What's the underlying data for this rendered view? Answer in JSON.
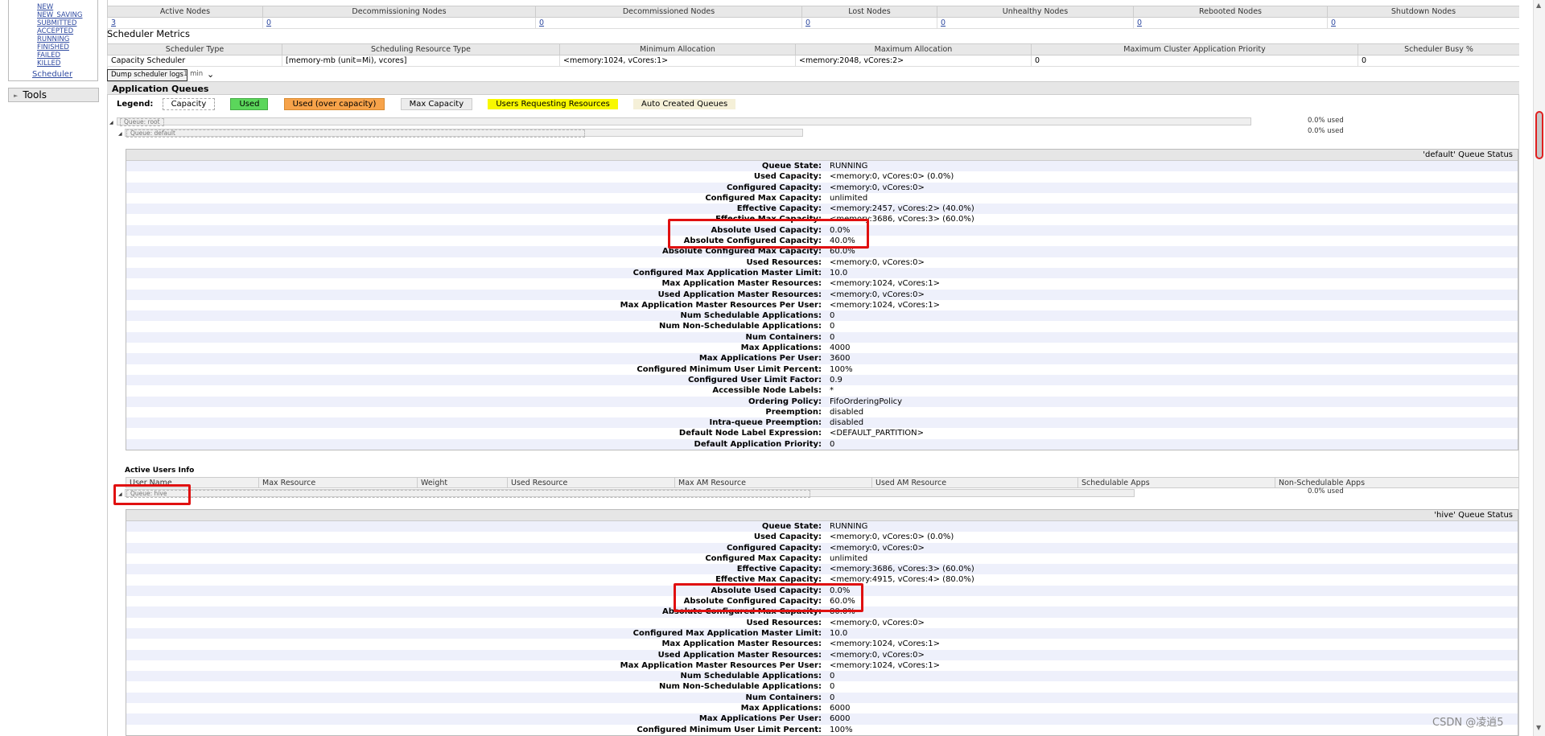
{
  "nav": {
    "states": [
      "NEW",
      "NEW_SAVING",
      "SUBMITTED",
      "ACCEPTED",
      "RUNNING",
      "FINISHED",
      "FAILED",
      "KILLED"
    ],
    "scheduler": "Scheduler",
    "tools": "Tools"
  },
  "cluster_nodes": {
    "headers": [
      "Active Nodes",
      "Decommissioning Nodes",
      "Decommissioned Nodes",
      "Lost Nodes",
      "Unhealthy Nodes",
      "Rebooted Nodes",
      "Shutdown Nodes"
    ],
    "values": [
      "3",
      "0",
      "0",
      "0",
      "0",
      "0",
      "0"
    ]
  },
  "scheduler_metrics": {
    "title": "Scheduler Metrics",
    "headers": [
      "Scheduler Type",
      "Scheduling Resource Type",
      "Minimum Allocation",
      "Maximum Allocation",
      "Maximum Cluster Application Priority",
      "Scheduler Busy %"
    ],
    "values": [
      "Capacity Scheduler",
      "[memory-mb (unit=Mi), vcores]",
      "<memory:1024, vCores:1>",
      "<memory:2048, vCores:2>",
      "0",
      "0"
    ]
  },
  "dump": {
    "button": "Dump scheduler logs",
    "interval": "1 min"
  },
  "app_queues": {
    "title": "Application Queues",
    "legend_label": "Legend:",
    "legend": [
      "Capacity",
      "Used",
      "Used (over capacity)",
      "Max Capacity",
      "Users Requesting Resources",
      "Auto Created Queues"
    ],
    "queues": [
      {
        "name": "Queue: root",
        "used": "0.0% used"
      },
      {
        "name": "Queue: default",
        "used": "0.0% used"
      },
      {
        "name": "Queue: hive",
        "used": "0.0% used"
      }
    ]
  },
  "default_status": {
    "title": "'default' Queue Status",
    "rows": [
      [
        "Queue State:",
        "RUNNING"
      ],
      [
        "Used Capacity:",
        "<memory:0, vCores:0> (0.0%)"
      ],
      [
        "Configured Capacity:",
        "<memory:0, vCores:0>"
      ],
      [
        "Configured Max Capacity:",
        "unlimited"
      ],
      [
        "Effective Capacity:",
        "<memory:2457, vCores:2> (40.0%)"
      ],
      [
        "Effective Max Capacity:",
        "<memory:3686, vCores:3> (60.0%)"
      ],
      [
        "Absolute Used Capacity:",
        "0.0%"
      ],
      [
        "Absolute Configured Capacity:",
        "40.0%"
      ],
      [
        "Absolute Configured Max Capacity:",
        "60.0%"
      ],
      [
        "Used Resources:",
        "<memory:0, vCores:0>"
      ],
      [
        "Configured Max Application Master Limit:",
        "10.0"
      ],
      [
        "Max Application Master Resources:",
        "<memory:1024, vCores:1>"
      ],
      [
        "Used Application Master Resources:",
        "<memory:0, vCores:0>"
      ],
      [
        "Max Application Master Resources Per User:",
        "<memory:1024, vCores:1>"
      ],
      [
        "Num Schedulable Applications:",
        "0"
      ],
      [
        "Num Non-Schedulable Applications:",
        "0"
      ],
      [
        "Num Containers:",
        "0"
      ],
      [
        "Max Applications:",
        "4000"
      ],
      [
        "Max Applications Per User:",
        "3600"
      ],
      [
        "Configured Minimum User Limit Percent:",
        "100%"
      ],
      [
        "Configured User Limit Factor:",
        "0.9"
      ],
      [
        "Accessible Node Labels:",
        "*"
      ],
      [
        "Ordering Policy:",
        "FifoOrderingPolicy"
      ],
      [
        "Preemption:",
        "disabled"
      ],
      [
        "Intra-queue Preemption:",
        "disabled"
      ],
      [
        "Default Node Label Expression:",
        "<DEFAULT_PARTITION>"
      ],
      [
        "Default Application Priority:",
        "0"
      ]
    ]
  },
  "active_users": {
    "title": "Active Users Info",
    "headers": [
      "User Name",
      "Max Resource",
      "Weight",
      "Used Resource",
      "Max AM Resource",
      "Used AM Resource",
      "Schedulable Apps",
      "Non-Schedulable Apps"
    ]
  },
  "hive_status": {
    "title": "'hive' Queue Status",
    "rows": [
      [
        "Queue State:",
        "RUNNING"
      ],
      [
        "Used Capacity:",
        "<memory:0, vCores:0> (0.0%)"
      ],
      [
        "Configured Capacity:",
        "<memory:0, vCores:0>"
      ],
      [
        "Configured Max Capacity:",
        "unlimited"
      ],
      [
        "Effective Capacity:",
        "<memory:3686, vCores:3> (60.0%)"
      ],
      [
        "Effective Max Capacity:",
        "<memory:4915, vCores:4> (80.0%)"
      ],
      [
        "Absolute Used Capacity:",
        "0.0%"
      ],
      [
        "Absolute Configured Capacity:",
        "60.0%"
      ],
      [
        "Absolute Configured Max Capacity:",
        "80.0%"
      ],
      [
        "Used Resources:",
        "<memory:0, vCores:0>"
      ],
      [
        "Configured Max Application Master Limit:",
        "10.0"
      ],
      [
        "Max Application Master Resources:",
        "<memory:1024, vCores:1>"
      ],
      [
        "Used Application Master Resources:",
        "<memory:0, vCores:0>"
      ],
      [
        "Max Application Master Resources Per User:",
        "<memory:1024, vCores:1>"
      ],
      [
        "Num Schedulable Applications:",
        "0"
      ],
      [
        "Num Non-Schedulable Applications:",
        "0"
      ],
      [
        "Num Containers:",
        "0"
      ],
      [
        "Max Applications:",
        "6000"
      ],
      [
        "Max Applications Per User:",
        "6000"
      ],
      [
        "Configured Minimum User Limit Percent:",
        "100%"
      ]
    ]
  },
  "watermark": "CSDN @凌逍5"
}
